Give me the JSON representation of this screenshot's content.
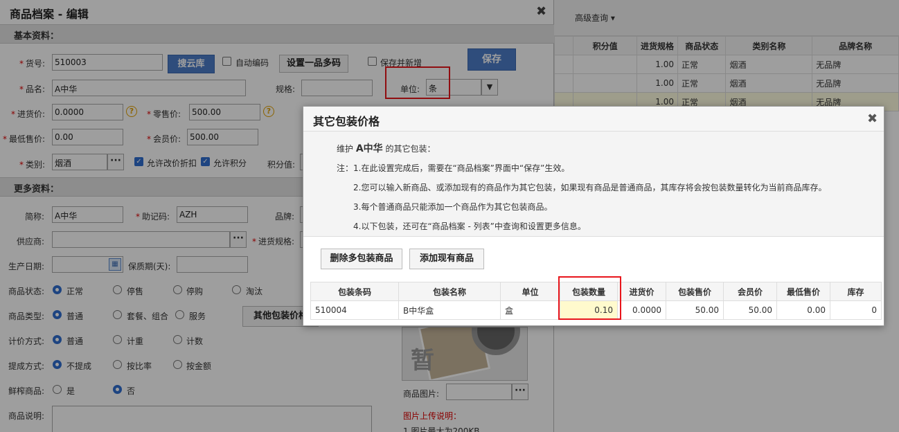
{
  "bg": {
    "adv_search": "高级查询",
    "headers": [
      "积分值",
      "进货规格",
      "商品状态",
      "类别名称",
      "品牌名称"
    ],
    "rows": [
      [
        "",
        "1.00",
        "正常",
        "烟酒",
        "无品牌"
      ],
      [
        "",
        "1.00",
        "正常",
        "烟酒",
        "无品牌"
      ],
      [
        "",
        "1.00",
        "正常",
        "烟酒",
        "无品牌"
      ]
    ]
  },
  "edit": {
    "title": "商品档案 - 编辑",
    "close": "✖",
    "sec_basic": "基本资料：",
    "sec_more": "更多资料：",
    "labels": {
      "code": "货号:",
      "name": "品名:",
      "spec": "规格:",
      "unit": "单位:",
      "purchase": "进货价:",
      "retail": "零售价:",
      "min_price": "最低售价:",
      "member": "会员价:",
      "category": "类别:",
      "points": "积分值:",
      "short": "简称:",
      "mnemonic": "助记码:",
      "brand": "品牌:",
      "supplier": "供应商:",
      "purchase_spec": "进货规格:",
      "prod_date": "生产日期:",
      "shelf": "保质期(天):",
      "status": "商品状态:",
      "type": "商品类型:",
      "pricing": "计价方式:",
      "commission": "提成方式:",
      "fresh": "鲜榨商品:",
      "desc": "商品说明:",
      "image": "商品图片:"
    },
    "values": {
      "code": "510003",
      "name": "A中华",
      "spec": "",
      "unit": "条",
      "purchase": "0.0000",
      "retail": "500.00",
      "min_price": "0.00",
      "member": "500.00",
      "category": "烟酒",
      "short": "A中华",
      "mnemonic": "AZH",
      "supplier": "",
      "prod_date": "",
      "shelf": ""
    },
    "buttons": {
      "search_cloud": "搜云库",
      "multi_code": "设置一品多码",
      "save": "保存",
      "other_pack": "其他包装价格"
    },
    "checks": {
      "auto_code": "自动编码",
      "save_new": "保存并新增",
      "allow_discount": "允许改价折扣",
      "allow_points": "允许积分"
    },
    "radios": {
      "status": [
        "正常",
        "停售",
        "停购",
        "淘汰"
      ],
      "type": [
        "普通",
        "套餐、组合",
        "服务"
      ],
      "pricing": [
        "普通",
        "计重",
        "计数"
      ],
      "commission": [
        "不提成",
        "按比率",
        "按金额"
      ],
      "fresh": [
        "是",
        "否"
      ]
    },
    "upload_title": "图片上传说明：",
    "upload_note": "1.图片最大为200KB",
    "placeholder_glyph": "暂"
  },
  "popup": {
    "title": "其它包装价格",
    "close": "✖",
    "maintain_pre": "维护",
    "maintain_name": "A中华",
    "maintain_post": "的其它包装：",
    "notes": [
      "注：1.在此设置完成后，需要在“商品档案”界面中“保存”生效。",
      "2.您可以输入新商品、或添加现有的商品作为其它包装，如果现有商品是普通商品，其库存将会按包装数量转化为当前商品库存。",
      "3.每个普通商品只能添加一个商品作为其它包装商品。",
      "4.以下包装，还可在“商品档案 - 列表”中查询和设置更多信息。"
    ],
    "btn_delete": "删除多包装商品",
    "btn_add": "添加现有商品",
    "headers": [
      "包装条码",
      "包装名称",
      "单位",
      "包装数量",
      "进货价",
      "包装售价",
      "会员价",
      "最低售价",
      "库存"
    ],
    "rows": [
      [
        "510004",
        "B中华盒",
        "盒",
        "0.10",
        "0.0000",
        "50.00",
        "50.00",
        "0.00",
        "0"
      ]
    ]
  },
  "colors": {
    "highlight_box": "#e8151b",
    "accent": "#4c7cc9"
  }
}
